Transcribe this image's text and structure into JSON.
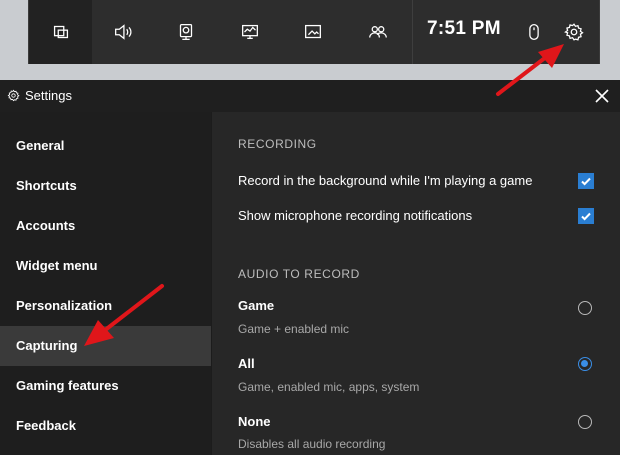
{
  "gamebar": {
    "time": "7:51 PM",
    "icons": [
      "widget-menu-icon",
      "audio-icon",
      "capture-icon",
      "performance-icon",
      "gallery-icon",
      "xbox-social-icon",
      "mouse-icon",
      "gear-icon"
    ]
  },
  "settings": {
    "title": "Settings",
    "nav": [
      {
        "label": "General"
      },
      {
        "label": "Shortcuts"
      },
      {
        "label": "Accounts"
      },
      {
        "label": "Widget menu"
      },
      {
        "label": "Personalization"
      },
      {
        "label": "Capturing",
        "selected": true
      },
      {
        "label": "Gaming features"
      },
      {
        "label": "Feedback"
      }
    ],
    "recording": {
      "heading": "RECORDING",
      "options": [
        {
          "label": "Record in the background while I'm playing a game",
          "checked": true
        },
        {
          "label": "Show microphone recording notifications",
          "checked": true
        }
      ]
    },
    "audio": {
      "heading": "AUDIO TO RECORD",
      "options": [
        {
          "title": "Game",
          "subtitle": "Game + enabled mic",
          "selected": false
        },
        {
          "title": "All",
          "subtitle": "Game, enabled mic, apps, system",
          "selected": true
        },
        {
          "title": "None",
          "subtitle": "Disables all audio recording",
          "selected": false
        }
      ]
    }
  },
  "colors": {
    "accent": "#2a7ed2",
    "arrow": "#e0161a"
  }
}
